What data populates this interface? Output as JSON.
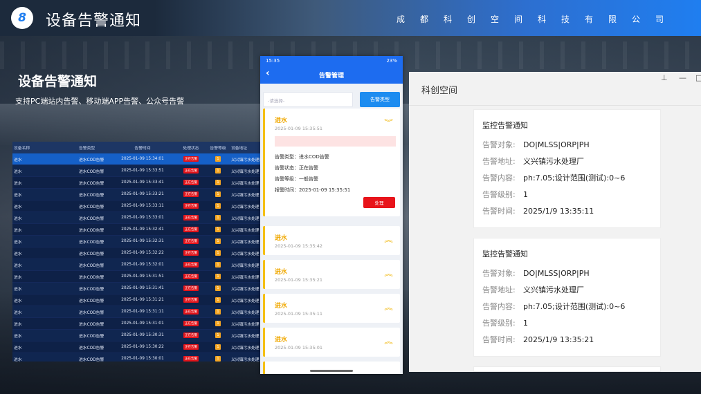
{
  "header": {
    "number": "8",
    "title": "设备告警通知",
    "company": "成都科创空间科技有限公司"
  },
  "intro": {
    "title": "设备告警通知",
    "subtitle": "支持PC端站内告警、移动端APP告警、公众号告警"
  },
  "pc_table": {
    "columns": [
      "设备名称",
      "告警类型",
      "告警时间",
      "处理状态",
      "告警等级",
      "设备地址"
    ],
    "status_label": "正在告警",
    "level_label": "1",
    "rows": [
      {
        "name": "进水",
        "type": "进水COD告警",
        "time": "2025-01-09 15:34:01",
        "addr": "义兴镇污水处理厂"
      },
      {
        "name": "进水",
        "type": "进水COD告警",
        "time": "2025-01-09 15:33:51",
        "addr": "义兴镇污水处理"
      },
      {
        "name": "进水",
        "type": "进水COD告警",
        "time": "2025-01-09 15:33:41",
        "addr": "义兴镇污水处理"
      },
      {
        "name": "进水",
        "type": "进水COD告警",
        "time": "2025-01-09 15:33:21",
        "addr": "义兴镇污水处理"
      },
      {
        "name": "进水",
        "type": "进水COD告警",
        "time": "2025-01-09 15:33:11",
        "addr": "义兴镇污水处理"
      },
      {
        "name": "进水",
        "type": "进水COD告警",
        "time": "2025-01-09 15:33:01",
        "addr": "义兴镇污水处理"
      },
      {
        "name": "进水",
        "type": "进水COD告警",
        "time": "2025-01-09 15:32:41",
        "addr": "义兴镇污水处理"
      },
      {
        "name": "进水",
        "type": "进水COD告警",
        "time": "2025-01-09 15:32:31",
        "addr": "义兴镇污水处理"
      },
      {
        "name": "进水",
        "type": "进水COD告警",
        "time": "2025-01-09 15:32:22",
        "addr": "义兴镇污水处理"
      },
      {
        "name": "进水",
        "type": "进水COD告警",
        "time": "2025-01-09 15:32:01",
        "addr": "义兴镇污水处理"
      },
      {
        "name": "进水",
        "type": "进水COD告警",
        "time": "2025-01-09 15:31:51",
        "addr": "义兴镇污水处理"
      },
      {
        "name": "进水",
        "type": "进水COD告警",
        "time": "2025-01-09 15:31:41",
        "addr": "义兴镇污水处理"
      },
      {
        "name": "进水",
        "type": "进水COD告警",
        "time": "2025-01-09 15:31:21",
        "addr": "义兴镇污水处理"
      },
      {
        "name": "进水",
        "type": "进水COD告警",
        "time": "2025-01-09 15:31:11",
        "addr": "义兴镇污水处理"
      },
      {
        "name": "进水",
        "type": "进水COD告警",
        "time": "2025-01-09 15:31:01",
        "addr": "义兴镇污水处理"
      },
      {
        "name": "进水",
        "type": "进水COD告警",
        "time": "2025-01-09 15:30:31",
        "addr": "义兴镇污水处理"
      },
      {
        "name": "进水",
        "type": "进水COD告警",
        "time": "2025-01-09 15:30:22",
        "addr": "义兴镇污水处理"
      },
      {
        "name": "进水",
        "type": "进水COD告警",
        "time": "2025-01-09 15:30:01",
        "addr": "义兴镇污水处理"
      }
    ]
  },
  "phone": {
    "status_time": "15:35",
    "status_right": "23%",
    "nav_title": "告警管理",
    "filter_placeholder": "-请选择-",
    "type_button": "告警类型",
    "expanded": {
      "title": "进水",
      "time": "2025-01-09 15:35:51",
      "type_line": "告警类型：进水COD告警",
      "status_line": "告警状态：正在告警",
      "level_line": "告警等级：一般告警",
      "report_line": "报警时间：2025-01-09 15:35:51",
      "handle_button": "处理"
    },
    "items": [
      {
        "title": "进水",
        "time": "2025-01-09 15:35:42"
      },
      {
        "title": "进水",
        "time": "2025-01-09 15:35:21"
      },
      {
        "title": "进水",
        "time": "2025-01-09 15:35:11"
      },
      {
        "title": "进水",
        "time": "2025-01-09 15:35:01"
      }
    ]
  },
  "right_panel": {
    "title": "科创空间",
    "notices": [
      {
        "head": "监控告警通知",
        "object_k": "告警对象:",
        "object_v": "DO|MLSS|ORP|PH",
        "addr_k": "告警地址:",
        "addr_v": "义兴镇污水处理厂",
        "content_k": "告警内容:",
        "content_v": "ph:7.05;设计范围(测试):0~6",
        "level_k": "告警级别:",
        "level_v": "1",
        "time_k": "告警时间:",
        "time_v": "2025/1/9 13:35:11"
      },
      {
        "head": "监控告警通知",
        "object_k": "告警对象:",
        "object_v": "DO|MLSS|ORP|PH",
        "addr_k": "告警地址:",
        "addr_v": "义兴镇污水处理厂",
        "content_k": "告警内容:",
        "content_v": "ph:7.05;设计范围(测试):0~6",
        "level_k": "告警级别:",
        "level_v": "1",
        "time_k": "告警时间:",
        "time_v": "2025/1/9 13:35:21"
      }
    ]
  }
}
